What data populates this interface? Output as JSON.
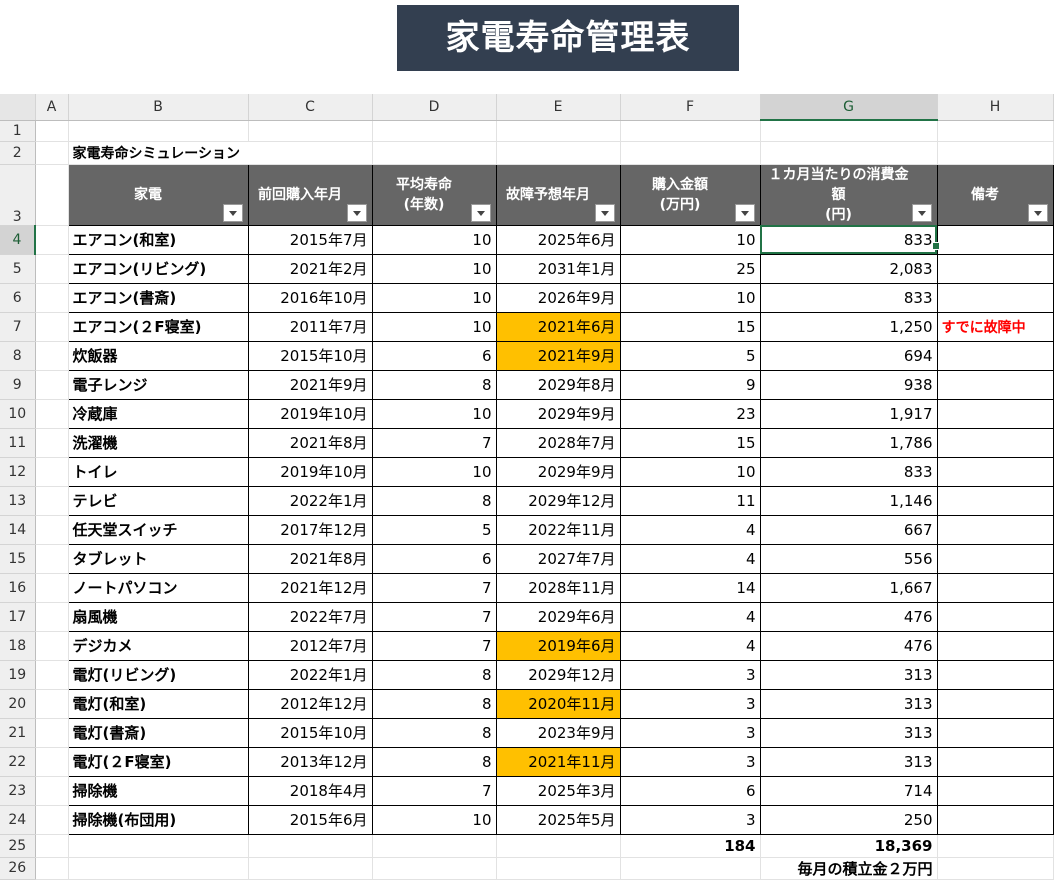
{
  "banner": {
    "title": "家電寿命管理表"
  },
  "sheet": {
    "columns": [
      "A",
      "B",
      "C",
      "D",
      "E",
      "F",
      "G",
      "H"
    ],
    "rownums": [
      "1",
      "2",
      "3",
      "4",
      "5",
      "6",
      "7",
      "8",
      "9",
      "10",
      "11",
      "12",
      "13",
      "14",
      "15",
      "16",
      "17",
      "18",
      "19",
      "20",
      "21",
      "22",
      "23",
      "24",
      "25",
      "26"
    ],
    "simulation_title": "家電寿命シミュレーション",
    "headers": {
      "appliance": "家電",
      "prev_purchase": "前回購入年月",
      "avg_life": "平均寿命\n(年数)",
      "failure_pred": "故障予想年月",
      "price": "購入金額\n(万円)",
      "monthly_cost": "１カ月当たりの消費金額\n(円)",
      "notes": "備考"
    },
    "rows": [
      {
        "name": "エアコン(和室)",
        "purchase": "2015年7月",
        "life": "10",
        "failure": "2025年6月",
        "price": "10",
        "monthly": "833",
        "note": ""
      },
      {
        "name": "エアコン(リビング)",
        "purchase": "2021年2月",
        "life": "10",
        "failure": "2031年1月",
        "price": "25",
        "monthly": "2,083",
        "note": ""
      },
      {
        "name": "エアコン(書斎)",
        "purchase": "2016年10月",
        "life": "10",
        "failure": "2026年9月",
        "price": "10",
        "monthly": "833",
        "note": ""
      },
      {
        "name": "エアコン(２F寝室)",
        "purchase": "2011年7月",
        "life": "10",
        "failure": "2021年6月",
        "price": "15",
        "monthly": "1,250",
        "note": "すでに故障中"
      },
      {
        "name": "炊飯器",
        "purchase": "2015年10月",
        "life": "6",
        "failure": "2021年9月",
        "price": "5",
        "monthly": "694",
        "note": ""
      },
      {
        "name": "電子レンジ",
        "purchase": "2021年9月",
        "life": "8",
        "failure": "2029年8月",
        "price": "9",
        "monthly": "938",
        "note": ""
      },
      {
        "name": "冷蔵庫",
        "purchase": "2019年10月",
        "life": "10",
        "failure": "2029年9月",
        "price": "23",
        "monthly": "1,917",
        "note": ""
      },
      {
        "name": "洗濯機",
        "purchase": "2021年8月",
        "life": "7",
        "failure": "2028年7月",
        "price": "15",
        "monthly": "1,786",
        "note": ""
      },
      {
        "name": "トイレ",
        "purchase": "2019年10月",
        "life": "10",
        "failure": "2029年9月",
        "price": "10",
        "monthly": "833",
        "note": ""
      },
      {
        "name": "テレビ",
        "purchase": "2022年1月",
        "life": "8",
        "failure": "2029年12月",
        "price": "11",
        "monthly": "1,146",
        "note": ""
      },
      {
        "name": "任天堂スイッチ",
        "purchase": "2017年12月",
        "life": "5",
        "failure": "2022年11月",
        "price": "4",
        "monthly": "667",
        "note": ""
      },
      {
        "name": "タブレット",
        "purchase": "2021年8月",
        "life": "6",
        "failure": "2027年7月",
        "price": "4",
        "monthly": "556",
        "note": ""
      },
      {
        "name": "ノートパソコン",
        "purchase": "2021年12月",
        "life": "7",
        "failure": "2028年11月",
        "price": "14",
        "monthly": "1,667",
        "note": ""
      },
      {
        "name": "扇風機",
        "purchase": "2022年7月",
        "life": "7",
        "failure": "2029年6月",
        "price": "4",
        "monthly": "476",
        "note": ""
      },
      {
        "name": "デジカメ",
        "purchase": "2012年7月",
        "life": "7",
        "failure": "2019年6月",
        "price": "4",
        "monthly": "476",
        "note": ""
      },
      {
        "name": "電灯(リビング)",
        "purchase": "2022年1月",
        "life": "8",
        "failure": "2029年12月",
        "price": "3",
        "monthly": "313",
        "note": ""
      },
      {
        "name": "電灯(和室)",
        "purchase": "2012年12月",
        "life": "8",
        "failure": "2020年11月",
        "price": "3",
        "monthly": "313",
        "note": ""
      },
      {
        "name": "電灯(書斎)",
        "purchase": "2015年10月",
        "life": "8",
        "failure": "2023年9月",
        "price": "3",
        "monthly": "313",
        "note": ""
      },
      {
        "name": "電灯(２F寝室)",
        "purchase": "2013年12月",
        "life": "8",
        "failure": "2021年11月",
        "price": "3",
        "monthly": "313",
        "note": ""
      },
      {
        "name": "掃除機",
        "purchase": "2018年4月",
        "life": "7",
        "failure": "2025年3月",
        "price": "6",
        "monthly": "714",
        "note": ""
      },
      {
        "name": "掃除機(布団用)",
        "purchase": "2015年6月",
        "life": "10",
        "failure": "2025年5月",
        "price": "3",
        "monthly": "250",
        "note": ""
      }
    ],
    "totals": {
      "price": "184",
      "monthly": "18,369",
      "savings": "毎月の積立金２万円"
    },
    "colors": {
      "highlight": "#ffc000",
      "header_bg": "#666666",
      "banner_bg": "#333f50",
      "note_red": "#ff0000",
      "selection": "#217346"
    }
  }
}
